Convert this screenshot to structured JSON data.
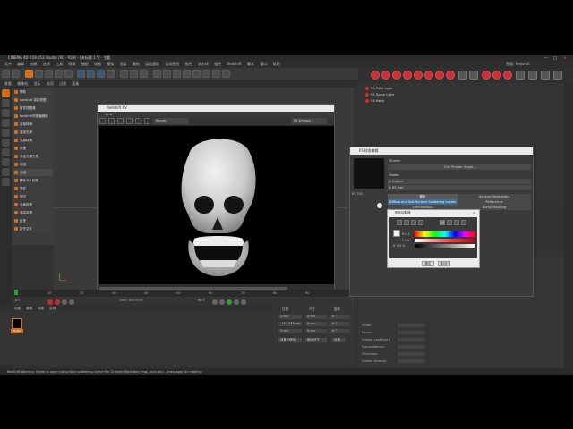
{
  "app": {
    "title": "CINEMA 4D R19.053 Studio (RC - R19) - [未标题 1 *] - 主要",
    "menu": [
      "文件",
      "编辑",
      "创建",
      "选择",
      "工具",
      "网格",
      "捕捉",
      "动画",
      "模拟",
      "渲染",
      "雕刻",
      "运动跟踪",
      "运动图形",
      "角色",
      "流水线",
      "插件",
      "Redshift",
      "脚本",
      "窗口",
      "帮助"
    ],
    "toolbar2_items": [
      "查看",
      "摄像机",
      "显示",
      "选项",
      "过滤",
      "面板"
    ],
    "layout_label": "界面: Redshift"
  },
  "left_menu": {
    "items": [
      "帮助",
      "Redshift 渲染视图",
      "材质视图器",
      "Redshift材质编辑器",
      "对象转换",
      "渲染光源",
      "光源转换",
      "代理",
      "添加光源工具",
      "烘焙",
      "分组",
      "移除 RS 标签",
      "修复",
      "测试",
      "全局设置",
      "渲染设置",
      "反馈",
      "打开文件"
    ]
  },
  "redshift_view": {
    "title": "Redshift RV",
    "menu": "View",
    "dropdown_left": "Beauty",
    "dropdown_right": "Fit Window"
  },
  "timeline": {
    "ticks": [
      "0",
      "10",
      "20",
      "30",
      "40",
      "50",
      "60",
      "70",
      "80",
      "90"
    ],
    "frame_display": "0 F",
    "frame_end": "90 F",
    "info": "Time: 00:00:00"
  },
  "material_manager": {
    "menu": [
      "创建",
      "编辑",
      "功能",
      "纹理"
    ],
    "material_label": "RS Mat"
  },
  "coordinates": {
    "header": [
      "位置",
      "尺寸",
      "旋转"
    ],
    "rows": [
      {
        "x": "0 cm",
        "sx": "0 cm",
        "r": "0 °"
      },
      {
        "x": "-141.346 cm",
        "sx": "0 cm",
        "r": "0 °"
      },
      {
        "x": "0 cm",
        "sx": "0 cm",
        "r": "0 °"
      }
    ],
    "mode": "对象 (相对)",
    "size_mode": "绝对尺寸",
    "apply": "应用"
  },
  "status": {
    "message": "Redshift Warning: Failed to open subsurface scattering cache file: D:/redshift/photon_map_auto.bin/...(message) for reading"
  },
  "objects": {
    "items": [
      "RS Point Light",
      "RS Dome Light",
      "RS Mesh"
    ]
  },
  "rs_material": {
    "title": "RS材质编辑",
    "preview_label": "RS 100",
    "header": "Shader",
    "edit_graph": "Edit Shader Graph...",
    "nodes": "Nodes",
    "output": "▸ Output",
    "rs_mat": "▸ RS Mat",
    "tabs": [
      "基本",
      "General Parameters",
      "Diffuse and Sub-Surface Scattering Layers",
      "Reflections",
      "Optimizations",
      "Bump Mapping"
    ]
  },
  "color_picker": {
    "title": "颜色拾取器",
    "labels": [
      "H 0.1",
      "S 0.0",
      "V 100 %"
    ],
    "ok": "确定",
    "cancel": "取消"
  },
  "attributes": {
    "rows": [
      "颜色",
      "权重",
      "粗糙度",
      "Phase",
      "Radius",
      "Scatter coefficient",
      "Transmittance",
      "Thickness",
      "Scatter Amount"
    ]
  }
}
